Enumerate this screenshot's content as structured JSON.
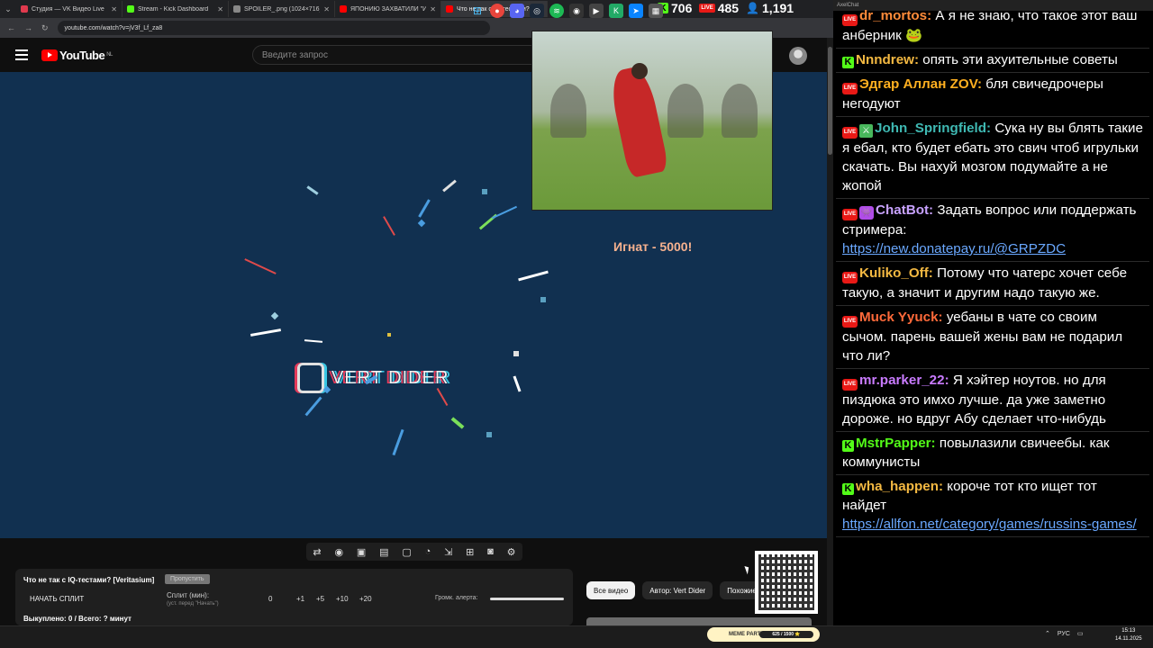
{
  "browser": {
    "tabs": [
      {
        "title": "Студия — VK Видео Live",
        "color": "#e03a4e"
      },
      {
        "title": "Stream - Kick Dashboard",
        "color": "#53fc18"
      },
      {
        "title": "SPOILER_.png (1024×716)",
        "color": "#888888"
      },
      {
        "title": "ЯПОНИЮ ЗАХВАТИЛИ \"ИНОС",
        "color": "#ff0000"
      },
      {
        "title": "Что не так с IQ-тестами? [Veri",
        "color": "#ff0000"
      }
    ],
    "url": "youtube.com/watch?v=jV3f_Lf_za8"
  },
  "stats": {
    "kick": "706",
    "live": "485",
    "viewers": "1,191",
    "live_badge": "LIVE"
  },
  "youtube": {
    "logo": "YouTube",
    "region": "NL",
    "search_placeholder": "Введите запрос"
  },
  "video": {
    "channel_logo_text": "VERT DIDER",
    "alert": "Игнат - 5000!"
  },
  "split_panel": {
    "title": "Что не так с IQ-тестами? [Veritasium]",
    "skip_label": "Пропустить",
    "start_label": "НАЧАТЬ СПЛИТ",
    "split_label": "Сплит (мин):",
    "split_hint": "(уст. перед \"Начать\")",
    "value": "0",
    "steps": [
      "+1",
      "+5",
      "+10",
      "+20"
    ],
    "volume_label": "Громк. алерта:",
    "summary": "Выкуплено: 0 / Всего: ? минут"
  },
  "chips": [
    "Все видео",
    "Автор: Vert Dider",
    "Похожие"
  ],
  "chat": {
    "header": "AxelChat",
    "messages": [
      {
        "badge": "live",
        "name": "dr_mortos:",
        "color": "#ff8c3a",
        "text": "А я не знаю, что такое этот ваш анберник 🐸",
        "first": true
      },
      {
        "badge": "kick",
        "name": "Nnndrew:",
        "color": "#f4b942",
        "text": "опять эти ахуительные советы"
      },
      {
        "badge": "live",
        "name": "Эдгар Аллан ZOV:",
        "color": "#ffb020",
        "text": "бля свичедрочеры негодуют"
      },
      {
        "badge": "live",
        "badge2": "sword",
        "name": "John_Springfield:",
        "color": "#3fb9b3",
        "text": "Сука ну вы блять такие я ебал, кто будет ебать это свич чтоб игрульки скачать. Вы нахуй мозгом подумайте а не жопой"
      },
      {
        "badge": "live",
        "badge2": "bot",
        "name": "ChatBot:",
        "color": "#c8a2ff",
        "text": "Задать вопрос или поддержать стримера:",
        "link": "https://new.donatepay.ru/@GRPZDC"
      },
      {
        "badge": "live",
        "name": "Kuliko_Off:",
        "color": "#f4b942",
        "text": "Потому что чатерс хочет себе такую, а значит и другим надо такую же."
      },
      {
        "badge": "live",
        "name": "Muck Yyuck:",
        "color": "#ff6a3a",
        "text": "уебаны в чате со своим сычом. парень вашей жены вам не подарил что ли?"
      },
      {
        "badge": "live",
        "name": "mr.parker_22:",
        "color": "#c97bff",
        "text": "Я хэйтер ноутов. но для пиздюка это имхо лучше. да уже заметно дороже. но вдруг Абу сделает что-нибудь"
      },
      {
        "badge": "kick",
        "name": "MstrPapper:",
        "color": "#53fc18",
        "text": "повылазили свичеебы. как коммунисты"
      },
      {
        "badge": "kick",
        "name": "wha_happen:",
        "color": "#f4b942",
        "text": "короче тот кто ищет тот найдет",
        "link": "https://allfon.net/category/games/russins-games/"
      }
    ]
  },
  "taskbar": {
    "meme_label": "MEME PARTY",
    "meme_progress": "625 / 1500 ⭐",
    "lang": "РУС",
    "time": "15:13",
    "date": "14.11.2025"
  }
}
